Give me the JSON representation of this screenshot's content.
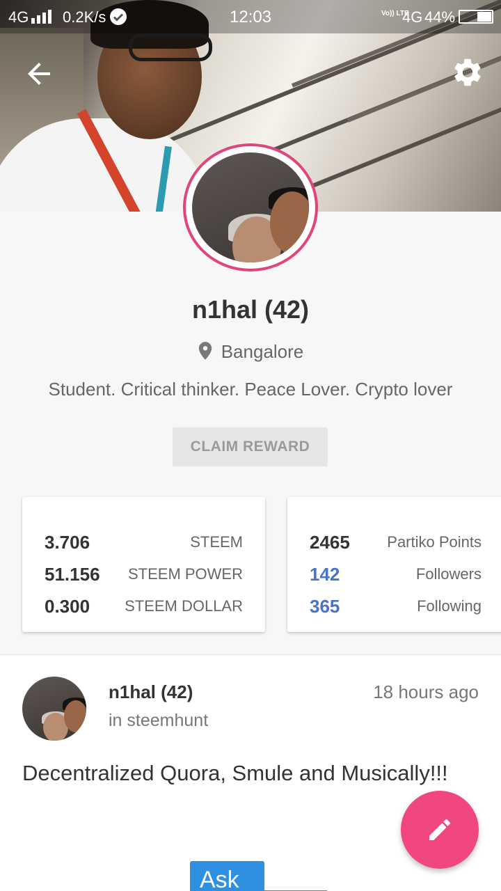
{
  "status_bar": {
    "network": "4G",
    "speed": "0.2K/s",
    "time": "12:03",
    "volte": "Vo)) LTE",
    "data_type": "4G",
    "battery": "44%"
  },
  "profile": {
    "name": "n1hal (42)",
    "location": "Bangalore",
    "bio": "Student. Critical thinker. Peace Lover. Crypto lover",
    "claim_label": "CLAIM REWARD",
    "ring_color": "#e0457b"
  },
  "wallet": [
    {
      "value": "3.706",
      "label": "STEEM"
    },
    {
      "value": "51.156",
      "label": "STEEM POWER"
    },
    {
      "value": "0.300",
      "label": "STEEM DOLLAR"
    }
  ],
  "social": [
    {
      "value": "2465",
      "label": "Partiko Points"
    },
    {
      "value": "142",
      "label": "Followers"
    },
    {
      "value": "365",
      "label": "Following"
    }
  ],
  "post": {
    "author": "n1hal (42)",
    "community": "in steemhunt",
    "time": "18 hours ago",
    "title": "Decentralized Quora, Smule and Musically!!!",
    "thumb_text": "Ask"
  },
  "colors": {
    "accent": "#f0487e",
    "link": "#4a72c9"
  },
  "icons": {
    "back": "arrow-back-icon",
    "settings": "gear-icon",
    "location": "location-pin-icon",
    "compose": "pencil-icon"
  }
}
